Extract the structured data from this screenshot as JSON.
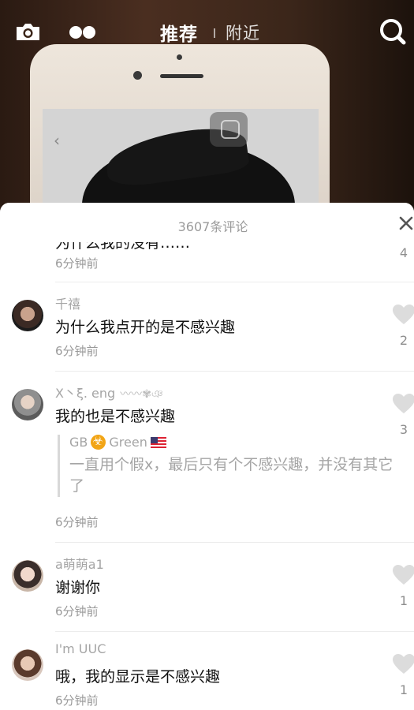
{
  "topbar": {
    "tab_recommend": "推荐",
    "tab_nearby": "附近",
    "icons": [
      "camera-icon",
      "dots-icon",
      "search-icon"
    ]
  },
  "sheet": {
    "comment_count": "3607条评论",
    "close_icon": "close-icon"
  },
  "comments": [
    {
      "user": "",
      "text": "为什么我的没有……",
      "time": "6分钟前",
      "likes": "4"
    },
    {
      "user": "千禧",
      "text": "为什么我点开的是不感兴趣",
      "time": "6分钟前",
      "likes": "2"
    },
    {
      "user": "X丶ξ. eng",
      "text": "我的也是不感兴趣",
      "time": "6分钟前",
      "likes": "3",
      "reply": {
        "user_prefix": "GB",
        "user_suffix": "Green",
        "text": "一直用个假x，最后只有个不感兴趣，并没有其它了"
      }
    },
    {
      "user": "a萌萌a1",
      "text": "谢谢你",
      "time": "6分钟前",
      "likes": "1"
    },
    {
      "user": "I'm UUC",
      "text": "哦，我的显示是不感兴趣",
      "time": "6分钟前",
      "likes": "1"
    }
  ]
}
